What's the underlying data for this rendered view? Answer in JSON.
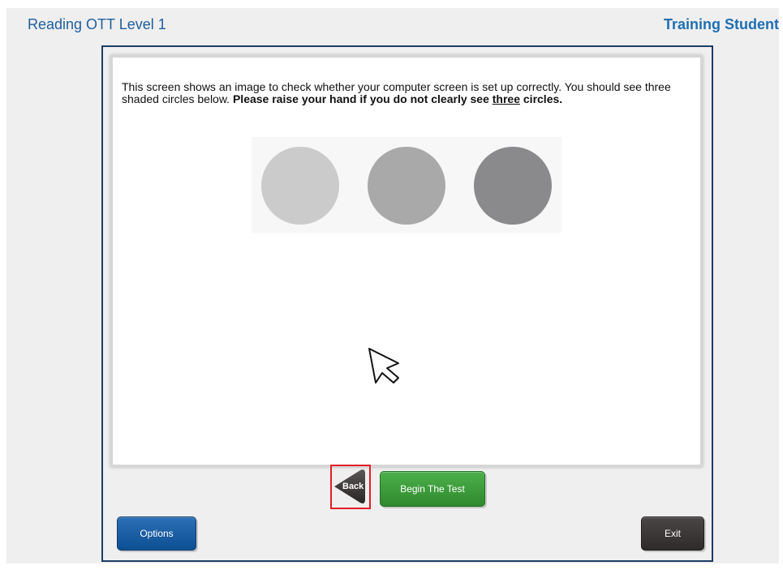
{
  "header": {
    "title": "Reading OTT Level 1",
    "user": "Training Student"
  },
  "content": {
    "text_plain": "This screen shows an image to check whether your computer screen is set up correctly. You should see three shaded circles below. ",
    "text_bold": "Please raise your hand if you do not clearly see ",
    "text_bold_underline": "three",
    "text_bold_end": " circles.",
    "circles": [
      {
        "color": "#cbcbcb"
      },
      {
        "color": "#a9a9a9"
      },
      {
        "color": "#8a8a8c"
      }
    ]
  },
  "nav": {
    "back_label": "Back",
    "begin_label": "Begin The Test",
    "options_label": "Options",
    "exit_label": "Exit"
  },
  "colors": {
    "brand_blue": "#1f5f9e",
    "begin_green": "#3a9a38",
    "options_blue": "#0d4f93",
    "exit_dark": "#2f2b2a",
    "highlight_red": "#e41e26"
  }
}
